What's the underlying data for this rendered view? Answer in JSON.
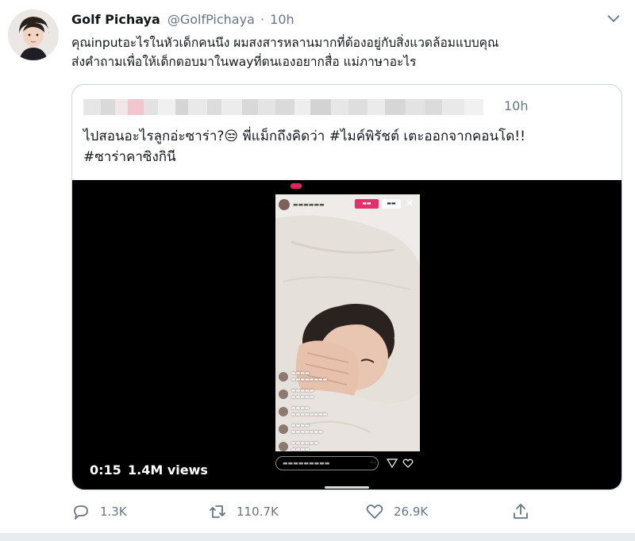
{
  "author": {
    "name": "Golf Pichaya",
    "handle": "@GolfPichaya",
    "separator": "·",
    "time": "10h"
  },
  "tweet": {
    "lines": [
      "คุณinputอะไรในหัวเด็กคนนึง ผมสงสารหลานมากที่ต้องอยู่กับสิ่งแวดล้อมแบบคุณ",
      "ส่งคำถามเพื่อให้เด็กตอบมาในwayที่ตนเองอยากสื่อ แม่ภาษาอะไร"
    ]
  },
  "quoted": {
    "time": "10h",
    "text_line1_a": "ไปสอนอะไรลูกอ่ะซาร่า?",
    "emoji": "😒",
    "text_line1_b": " พี่แม็กถึงคิดว่า ",
    "hashtag1": "#ไมค์พิรัชต์",
    "text_line1_c": " เตะออกจากคอนโด!!",
    "hashtag2": "#ซาร่าคาซิงกินี"
  },
  "video": {
    "elapsed": "0:15",
    "views": "1.4M views"
  },
  "actions": {
    "replies": "1.3K",
    "retweets": "110.7K",
    "likes": "26.9K"
  },
  "icons": {
    "caret": "chevron-down-icon",
    "reply": "reply-icon",
    "retweet": "retweet-icon",
    "like": "heart-icon",
    "share": "share-icon"
  },
  "colors": {
    "text": "#14171a",
    "muted": "#657786",
    "border": "#ccd6dd",
    "live": "#e1306c"
  }
}
